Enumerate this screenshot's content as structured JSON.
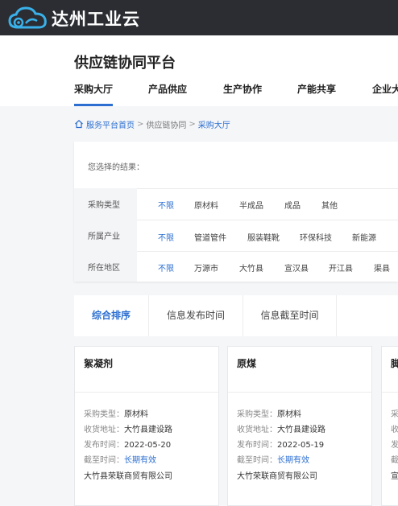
{
  "site": {
    "name": "达州工业云"
  },
  "header": {
    "title": "供应链协同平台",
    "tabs": [
      {
        "label": "采购大厅"
      },
      {
        "label": "产品供应"
      },
      {
        "label": "生产协作"
      },
      {
        "label": "产能共享"
      },
      {
        "label": "企业大"
      }
    ]
  },
  "breadcrumb": {
    "items": [
      {
        "label": "服务平台首页"
      },
      {
        "label": "供应链协同"
      },
      {
        "label": "采购大厅"
      }
    ],
    "separator": ">"
  },
  "filters": {
    "selected_label": "您选择的结果：",
    "rows": [
      {
        "label": "采购类型",
        "options": [
          "不限",
          "原材料",
          "半成品",
          "成品",
          "其他"
        ]
      },
      {
        "label": "所属产业",
        "options": [
          "不限",
          "管道管件",
          "服装鞋靴",
          "环保科技",
          "新能源"
        ]
      },
      {
        "label": "所在地区",
        "options": [
          "不限",
          "万源市",
          "大竹县",
          "宣汉县",
          "开江县",
          "渠县"
        ]
      }
    ]
  },
  "sort": {
    "tabs": [
      {
        "label": "综合排序"
      },
      {
        "label": "信息发布时间"
      },
      {
        "label": "信息截至时间"
      }
    ]
  },
  "card_labels": {
    "type": "采购类型：",
    "address": "收货地址：",
    "publish": "发布时间：",
    "deadline": "截至时间："
  },
  "cards": [
    {
      "title": "絮凝剂",
      "type": "原材料",
      "address": "大竹县建设路",
      "publish": "2022-05-20",
      "deadline": "长期有效",
      "company": "大竹县荣联商贸有限公司"
    },
    {
      "title": "原煤",
      "type": "原材料",
      "address": "大竹县建设路",
      "publish": "2022-05-19",
      "deadline": "长期有效",
      "company": "大竹荣联商贸有限公司"
    },
    {
      "title": "脚",
      "type": "",
      "address": "",
      "publish": "",
      "deadline": "",
      "company": ""
    }
  ],
  "partial_card_labels": {
    "type": "采",
    "address": "收",
    "publish": "发",
    "deadline": "截",
    "company": "宣"
  },
  "colors": {
    "accent": "#2c6fd1",
    "topbar": "#2b2d33"
  }
}
